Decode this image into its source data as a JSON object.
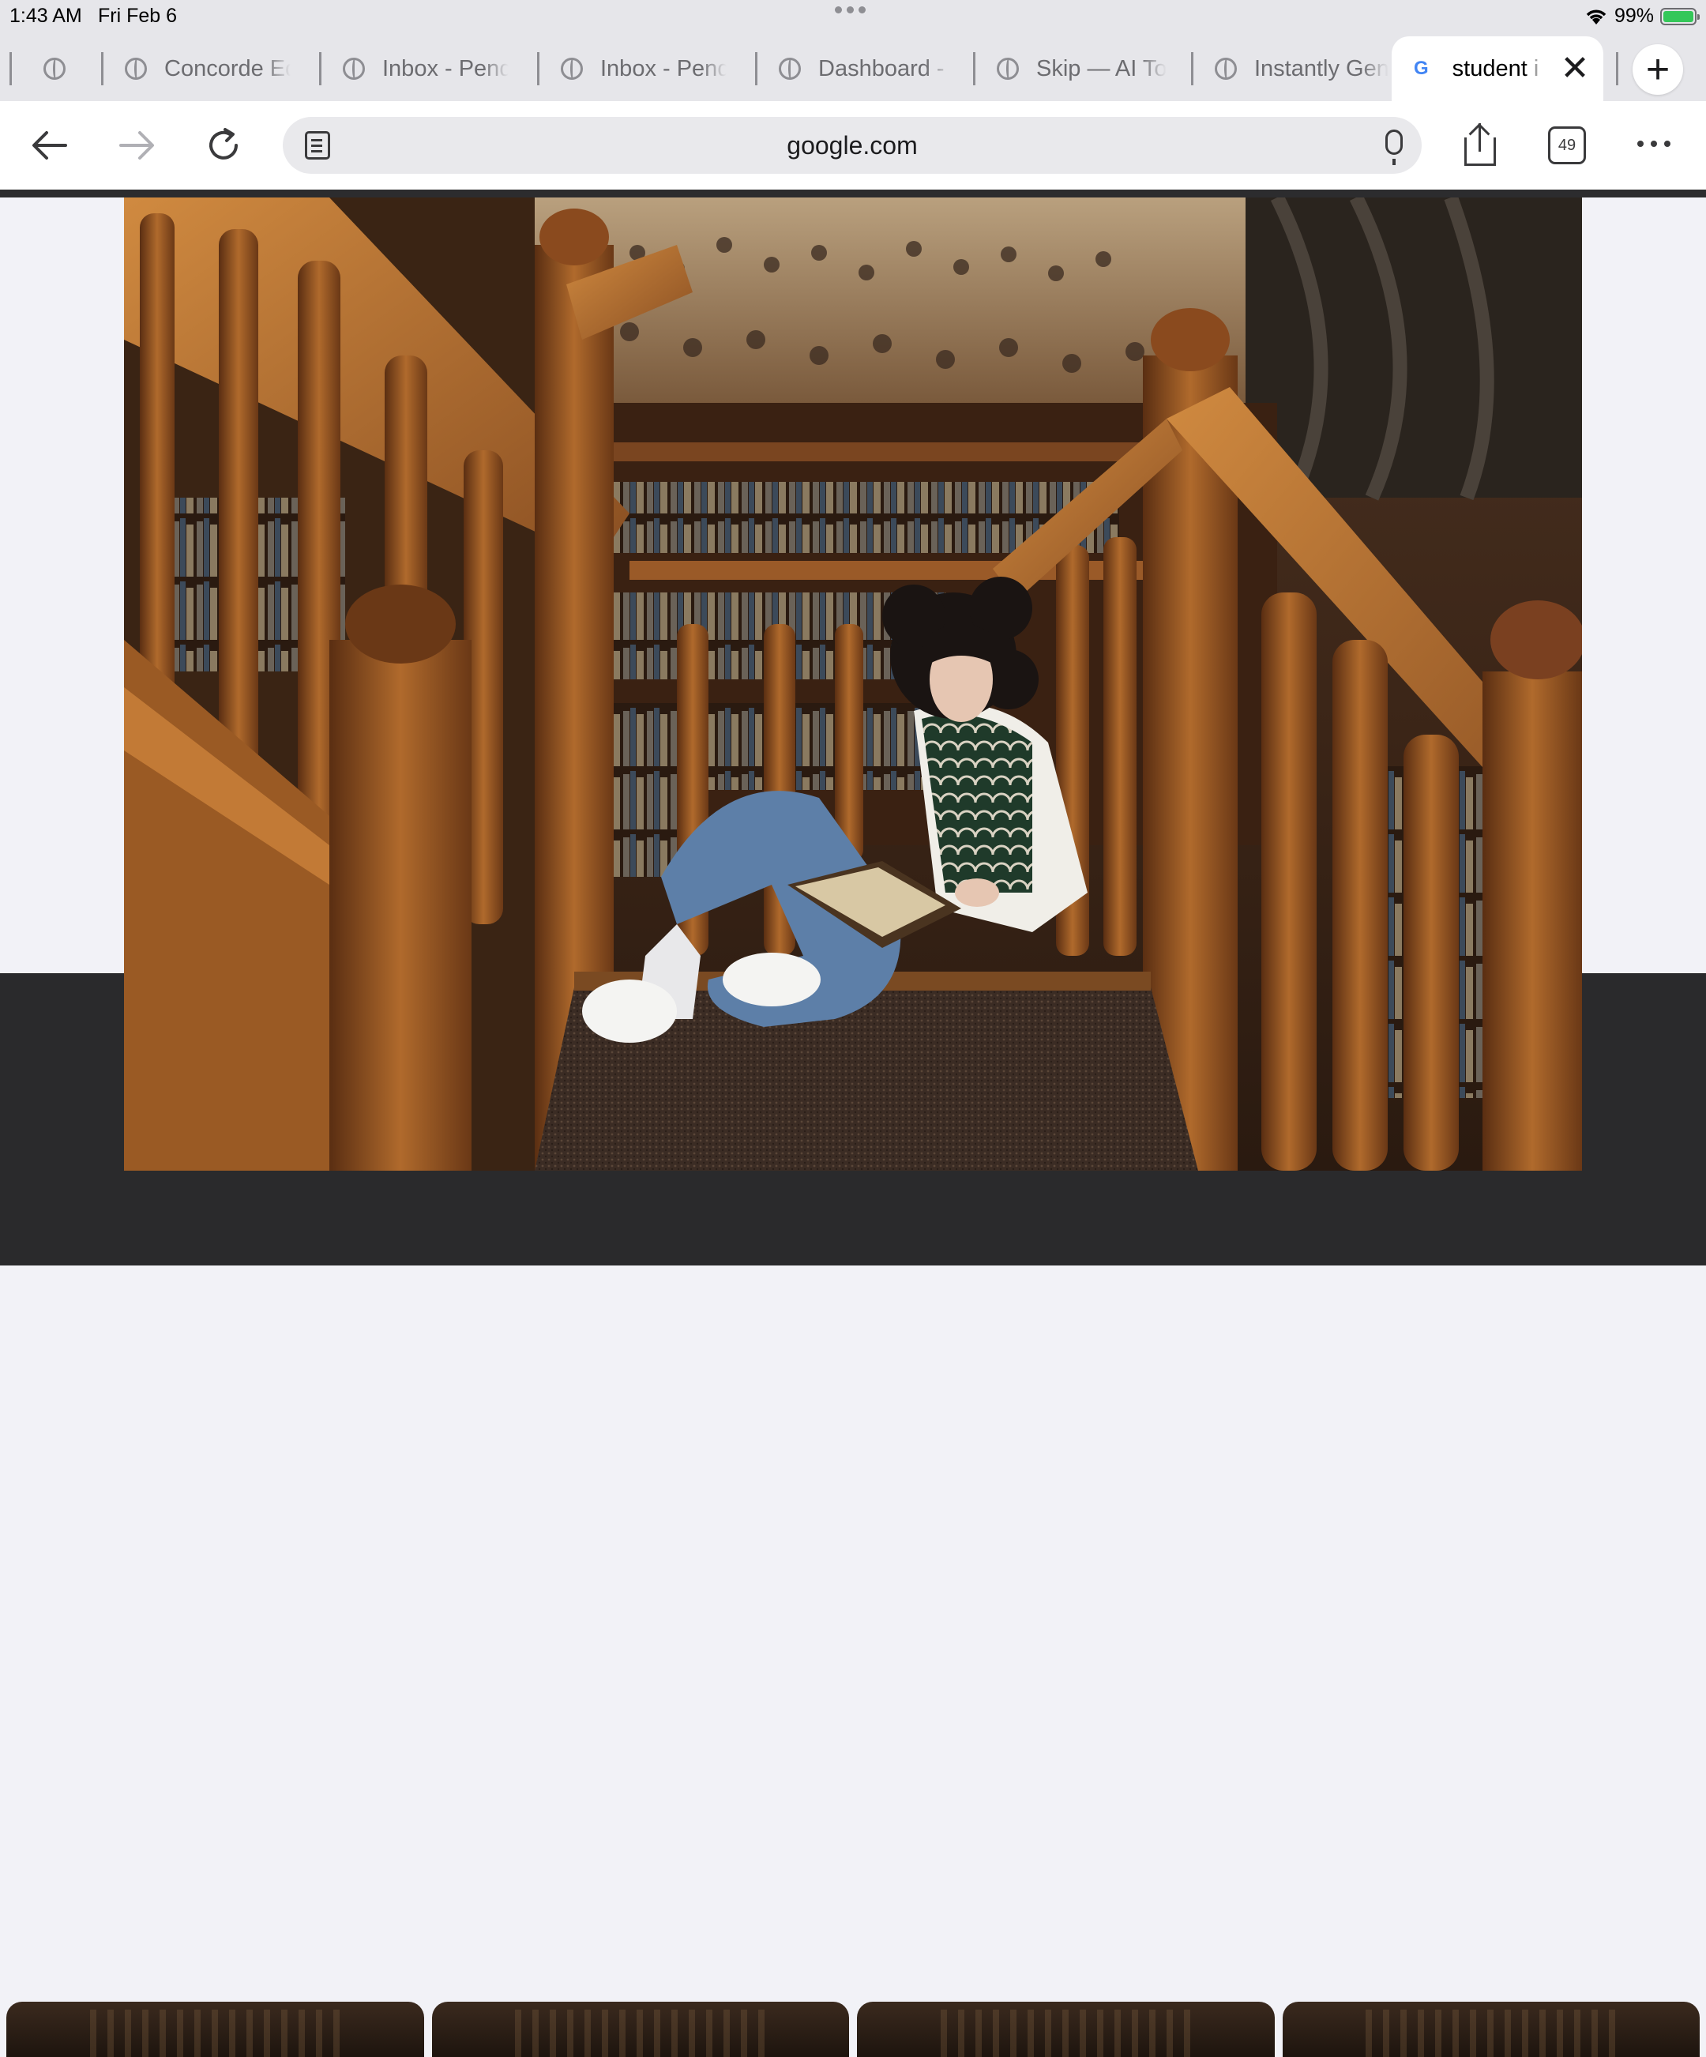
{
  "status_bar": {
    "time": "1:43 AM",
    "date": "Fri Feb 6",
    "battery": "99%"
  },
  "tabs": [
    {
      "title": "Concorde Ed"
    },
    {
      "title": "Inbox - Pend"
    },
    {
      "title": "Inbox - Pend"
    },
    {
      "title": "Dashboard -"
    },
    {
      "title": "Skip — AI Too"
    },
    {
      "title": "Instantly Gen"
    }
  ],
  "active_tab": {
    "title": "student i",
    "logo": "G"
  },
  "toolbar": {
    "url": "google.com",
    "tab_count": "49"
  },
  "colors": {
    "chrome_bg": "#e6e6ea",
    "toolbar_bg": "#ffffff",
    "dark_panel": "#2a2a2c",
    "wood": "#8a4f22",
    "battery_green": "#34c759"
  },
  "icons": [
    "wifi-icon",
    "battery-icon",
    "globe-icon",
    "google-g-icon",
    "close-icon",
    "plus-icon",
    "back-icon",
    "forward-icon",
    "reload-icon",
    "reader-icon",
    "mic-icon",
    "share-icon",
    "tab-count-icon",
    "more-icon"
  ]
}
